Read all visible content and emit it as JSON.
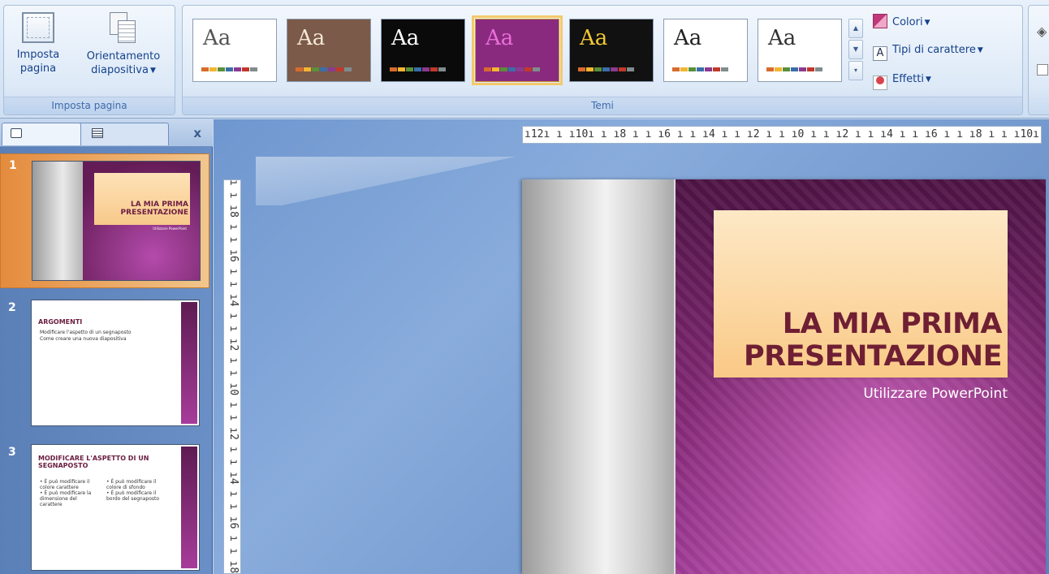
{
  "ribbon": {
    "page_setup_group": {
      "label": "Imposta pagina",
      "setup_button": {
        "line1": "Imposta",
        "line2": "pagina"
      },
      "orientation_button": {
        "line1": "Orientamento",
        "line2": "diapositiva"
      }
    },
    "themes_group": {
      "label": "Temi",
      "themes": [
        {
          "label": "Aa",
          "bg": "#ffffff",
          "fg": "#555555"
        },
        {
          "label": "Aa",
          "bg": "#7b5a49",
          "fg": "#f3e7d6"
        },
        {
          "label": "Aa",
          "bg": "#0a0a0a",
          "fg": "#ffffff"
        },
        {
          "label": "Aa",
          "bg": "#8a2a7f",
          "fg": "#e86fd8"
        },
        {
          "label": "Aa",
          "bg": "#111111",
          "fg": "#f2c832"
        },
        {
          "label": "Aa",
          "bg": "#ffffff",
          "fg": "#222222"
        },
        {
          "label": "Aa",
          "bg": "#ffffff",
          "fg": "#333333"
        }
      ],
      "selected_index": 3,
      "colors_label": "Colori",
      "fonts_label": "Tipi di carattere",
      "effects_label": "Effetti"
    }
  },
  "slides_pane": {
    "thumbnails": [
      {
        "number": "1",
        "title": "LA MIA PRIMA PRESENTAZIONE",
        "subtitle": "Utilizzare PowerPoint"
      },
      {
        "number": "2",
        "title": "ARGOMENTI",
        "bullets": [
          "Modificare l'aspetto di un segnaposto",
          "Come creare una nuova diapositiva"
        ]
      },
      {
        "number": "3",
        "title": "MODIFICARE L'ASPETTO DI UN SEGNAPOSTO",
        "col1": "• È può modificare il colore carattere\n• È può modificare la dimensione del carattere",
        "col2": "• È può modificare il colore di sfondo\n• È può modificare il bordo del segnaposto"
      }
    ],
    "close_label": "x"
  },
  "rulers": {
    "horizontal": "ı12ı ı ı10ı ı ı8 ı ı ı6 ı ı ı4 ı ı ı2 ı ı ı0 ı ı ı2 ı ı ı4 ı ı ı6 ı ı ı8 ı ı ı10ı ı ı12ı",
    "vertical": "ı ı ı8 ı ı ı6 ı ı ı4 ı ı ı2 ı ı ı0 ı ı ı2 ı ı ı4 ı ı ı6 ı ı ı8 ı ı ı"
  },
  "slide": {
    "title_line1": "LA MIA PRIMA",
    "title_line2": "PRESENTAZIONE",
    "subtitle": "Utilizzare PowerPoint"
  }
}
